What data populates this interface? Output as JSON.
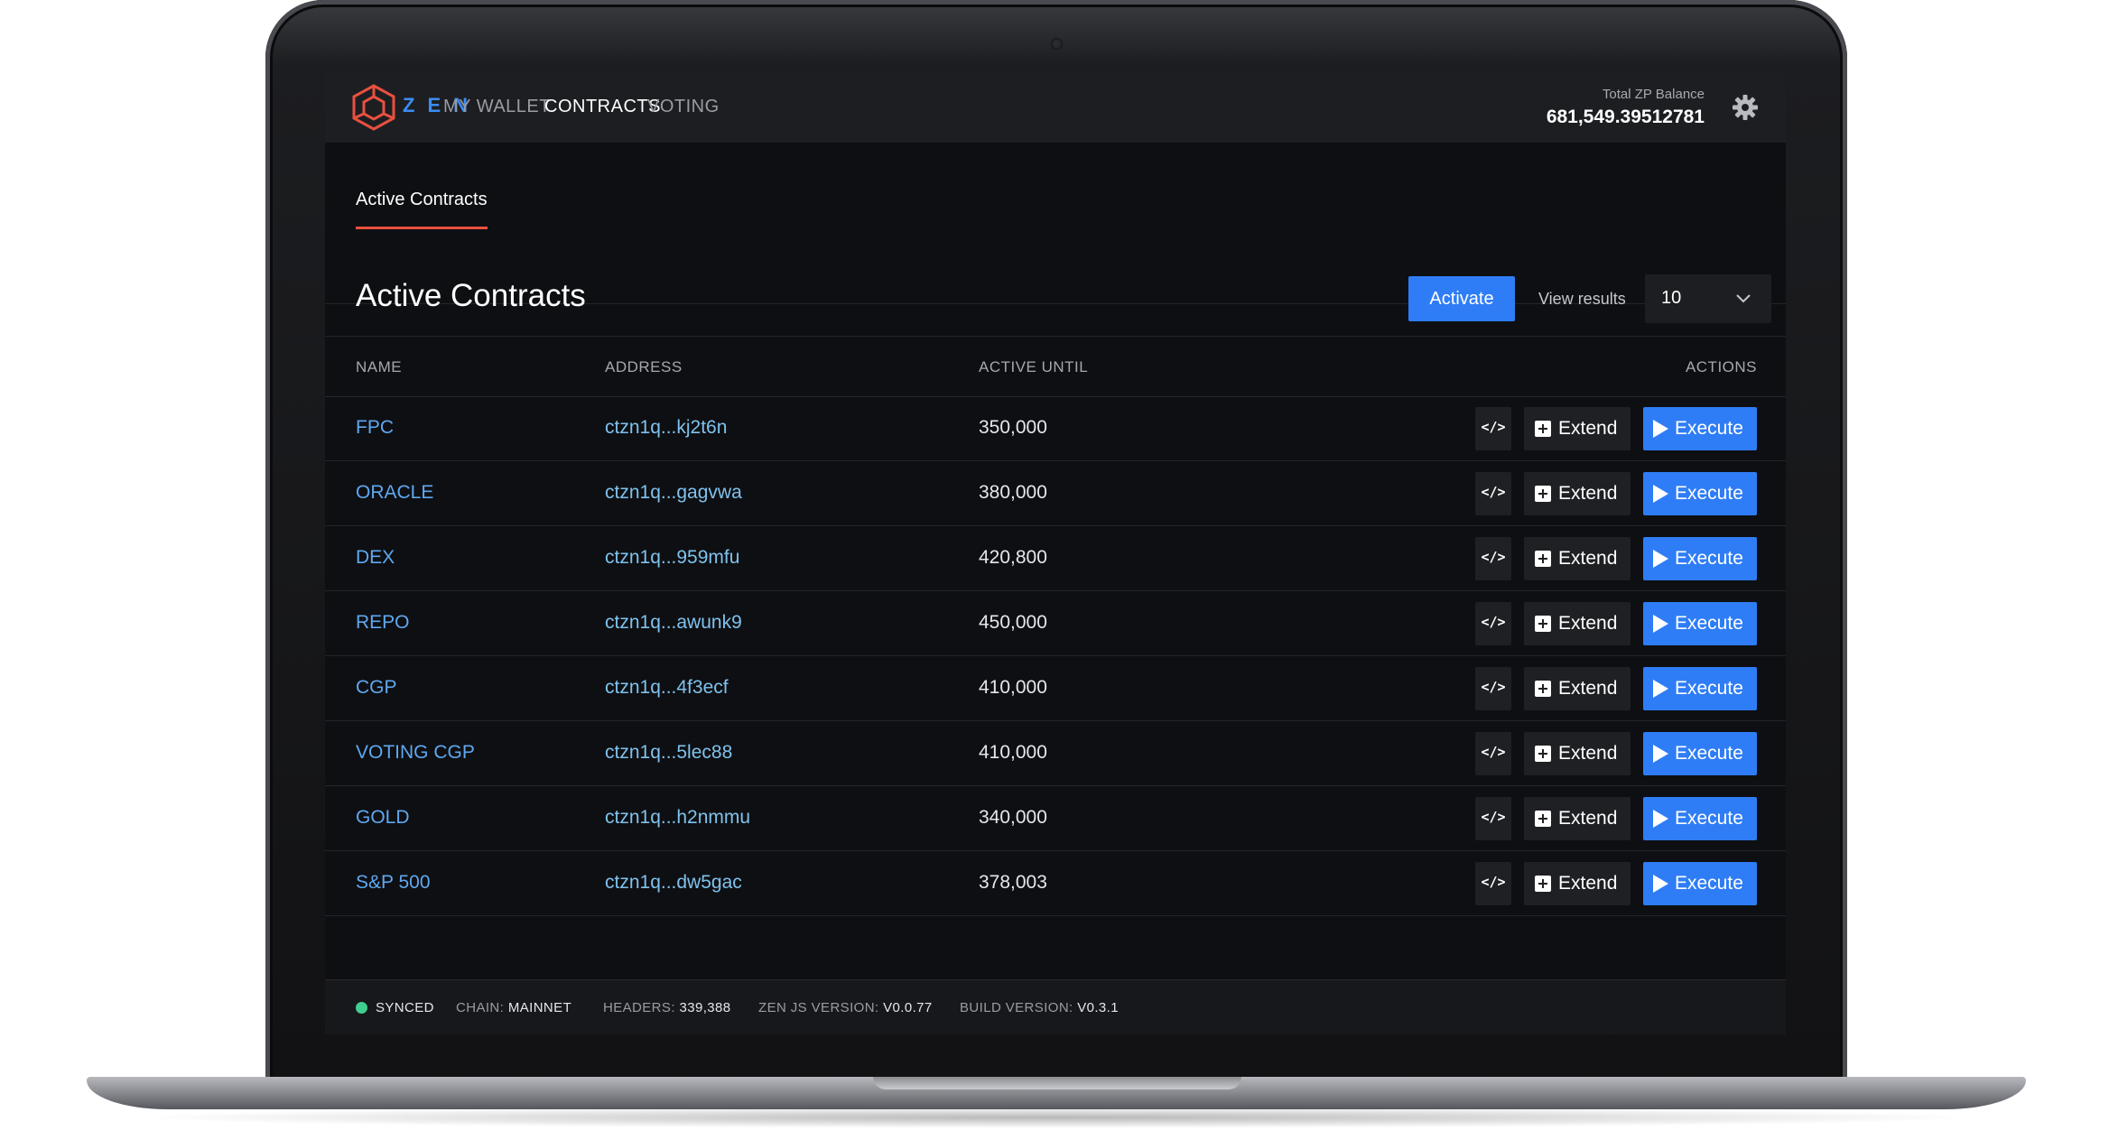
{
  "app": {
    "logo_text": "ZEN",
    "nav": [
      {
        "label": "MY WALLET",
        "active": false
      },
      {
        "label": "CONTRACTS",
        "active": true
      },
      {
        "label": "VOTING",
        "active": false
      }
    ],
    "balance_label": "Total ZP Balance",
    "balance_value": "681,549.39512781",
    "settings_icon": "gear-icon"
  },
  "subnav": {
    "tab_label": "Active Contracts"
  },
  "main": {
    "title": "Active Contracts",
    "activate_label": "Activate",
    "view_results_label": "View results",
    "view_results_value": "10"
  },
  "table": {
    "columns": {
      "name": "NAME",
      "address": "ADDRESS",
      "active_until": "ACTIVE UNTIL",
      "actions": "ACTIONS"
    },
    "code_label": "</>",
    "extend_label": "Extend",
    "execute_label": "Execute",
    "rows": [
      {
        "name": "FPC",
        "address": "ctzn1q...kj2t6n",
        "active_until": "350,000"
      },
      {
        "name": "ORACLE",
        "address": "ctzn1q...gagvwa",
        "active_until": "380,000"
      },
      {
        "name": "DEX",
        "address": "ctzn1q...959mfu",
        "active_until": "420,800"
      },
      {
        "name": "REPO",
        "address": "ctzn1q...awunk9",
        "active_until": "450,000"
      },
      {
        "name": "CGP",
        "address": "ctzn1q...4f3ecf",
        "active_until": "410,000"
      },
      {
        "name": "VOTING CGP",
        "address": "ctzn1q...5lec88",
        "active_until": "410,000"
      },
      {
        "name": "GOLD",
        "address": "ctzn1q...h2nmmu",
        "active_until": "340,000"
      },
      {
        "name": "S&P 500",
        "address": "ctzn1q...dw5gac",
        "active_until": "378,003"
      }
    ]
  },
  "footer": {
    "synced": "SYNCED",
    "chain_label": "CHAIN:",
    "chain_value": "MAINNET",
    "headers_label": "HEADERS:",
    "headers_value": "339,388",
    "zenjs_label": "ZEN JS VERSION:",
    "zenjs_value": "V0.0.77",
    "build_label": "BUILD VERSION:",
    "build_value": "V0.3.1"
  },
  "colors": {
    "accent": "#2f7df6",
    "tab_underline": "#e9503f",
    "synced": "#3fce8f",
    "link": "#5fa8f0"
  }
}
